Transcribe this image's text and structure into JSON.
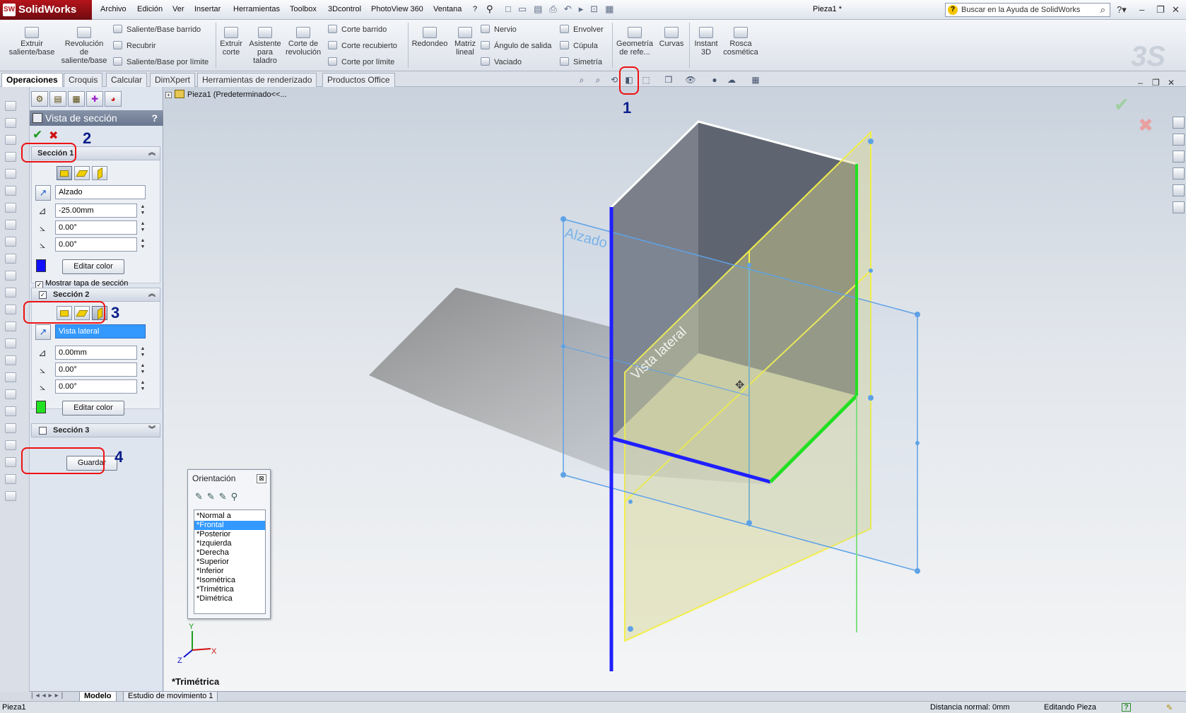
{
  "app": {
    "logo": "SolidWorks",
    "document_title": "Pieza1 *",
    "search_placeholder": "Buscar en la Ayuda de SolidWorks"
  },
  "menu": [
    "Archivo",
    "Edición",
    "Ver",
    "Insertar",
    "Herramientas",
    "Toolbox",
    "3Dcontrol",
    "PhotoView 360",
    "Ventana",
    "?"
  ],
  "command_manager": {
    "big_tools": [
      "Extruir saliente/base",
      "Revolución de saliente/base",
      "Extruir corte",
      "Asistente para taladro",
      "Corte de revolución",
      "Redondeo",
      "Matriz lineal",
      "Geometría de refe...",
      "Curvas",
      "Instant 3D",
      "Rosca cosmética"
    ],
    "small_tools_col1": [
      "Saliente/Base barrido",
      "Recubrir",
      "Saliente/Base por límite"
    ],
    "small_tools_col2": [
      "Corte barrido",
      "Corte recubierto",
      "Corte por límite"
    ],
    "small_tools_col3": [
      "Nervio",
      "Ángulo de salida",
      "Vaciado"
    ],
    "small_tools_col4": [
      "Envolver",
      "Cúpula",
      "Simetría"
    ]
  },
  "tabs": [
    "Operaciones",
    "Croquis",
    "Calcular",
    "DimXpert",
    "Herramientas de renderizado",
    "Productos Office"
  ],
  "tree_flyout": "Pieza1  (Predeterminado<<...",
  "property_manager": {
    "title": "Vista de sección",
    "help": "?",
    "section1": {
      "title": "Sección 1",
      "plane": "Alzado",
      "offset": "-25.00mm",
      "angle_x": "0.00°",
      "angle_y": "0.00°",
      "color_button": "Editar color",
      "color": "#1010ff",
      "show_cap_label": "Mostrar tapa de sección",
      "show_cap_checked": true
    },
    "section2": {
      "title": "Sección 2",
      "checked": true,
      "plane": "Vista lateral",
      "offset": "0.00mm",
      "angle_x": "0.00°",
      "angle_y": "0.00°",
      "color_button": "Editar color",
      "color": "#22e022"
    },
    "section3": {
      "title": "Sección 3",
      "checked": false
    },
    "save_button": "Guardar"
  },
  "callouts": [
    "1",
    "2",
    "3",
    "4"
  ],
  "viewport": {
    "plane_labels": [
      "Alzado",
      "Vista lateral"
    ],
    "view_name": "*Trimétrica",
    "axes": [
      "Y",
      "X",
      "Z"
    ]
  },
  "orientation_dialog": {
    "title": "Orientación",
    "views": [
      "*Normal a",
      "*Frontal",
      "*Posterior",
      "*Izquierda",
      "*Derecha",
      "*Superior",
      "*Inferior",
      "*Isométrica",
      "*Trimétrica",
      "*Dimétrica"
    ],
    "selected": "*Frontal"
  },
  "bottom_tabs": [
    "Modelo",
    "Estudio de movimiento 1"
  ],
  "status": {
    "left": "Pieza1",
    "normal_distance": "Distancia normal: 0mm",
    "mode": "Editando Pieza",
    "help": "?"
  }
}
